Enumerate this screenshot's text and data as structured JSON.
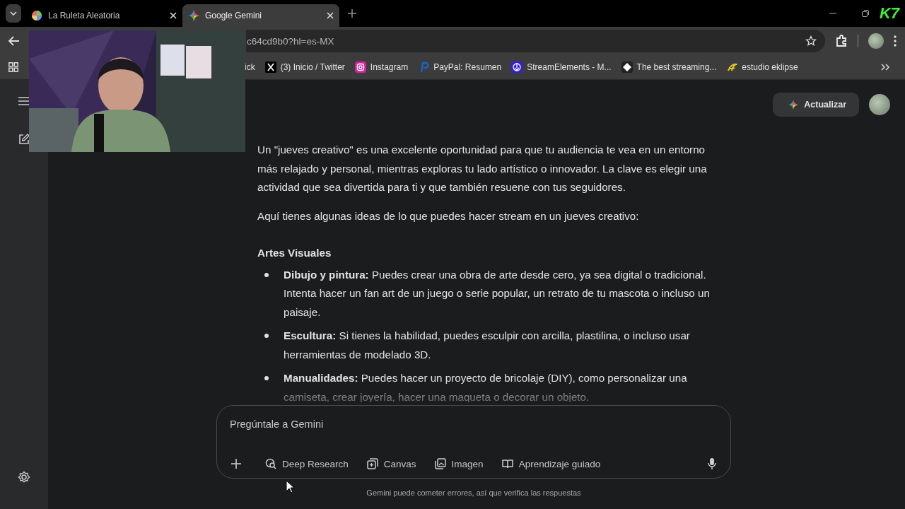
{
  "browser": {
    "tabs": [
      {
        "title": "La Ruleta Aleatoria",
        "selected": false
      },
      {
        "title": "Google Gemini",
        "selected": true
      }
    ],
    "overlay_logo": "K7",
    "address": "c64cd9b0?hl=es-MX",
    "bookmarks": [
      {
        "label": "ick"
      },
      {
        "label": "(3) Inicio / Twitter"
      },
      {
        "label": "Instagram"
      },
      {
        "label": "PayPal: Resumen"
      },
      {
        "label": "StreamElements - M..."
      },
      {
        "label": "The best streaming..."
      },
      {
        "label": "estudio eklipse"
      }
    ]
  },
  "header": {
    "upgrade_button": "Actualizar"
  },
  "response": {
    "paragraphs": [
      "Un \"jueves creativo\" es una excelente oportunidad para que tu audiencia te vea en un entorno más relajado y personal, mientras exploras tu lado artístico o innovador. La clave es elegir una actividad que sea divertida para ti y que también resuene con tus seguidores.",
      "Aquí tienes algunas ideas de lo que puedes hacer stream en un jueves creativo:"
    ],
    "heading": "Artes Visuales",
    "bullets": [
      "**Dibujo y pintura:** Puedes crear una obra de arte desde cero, ya sea digital o tradicional. Intenta hacer un fan art de un juego o serie popular, un retrato de tu mascota o incluso un paisaje.",
      "**Escultura:** Si tienes la habilidad, puedes esculpir con arcilla, plastilina, o incluso usar herramientas de modelado 3D.",
      "**Manualidades:** Puedes hacer un proyecto de bricolaje (DIY), como personalizar una camiseta, crear joyería, hacer una maqueta o decorar un objeto."
    ]
  },
  "prompt": {
    "placeholder": "Pregúntale a Gemini",
    "tools": [
      "Deep Research",
      "Canvas",
      "Imagen",
      "Aprendizaje guiado"
    ]
  },
  "disclaimer": "Gemini puede cometer errores, así que verifica las respuestas"
}
